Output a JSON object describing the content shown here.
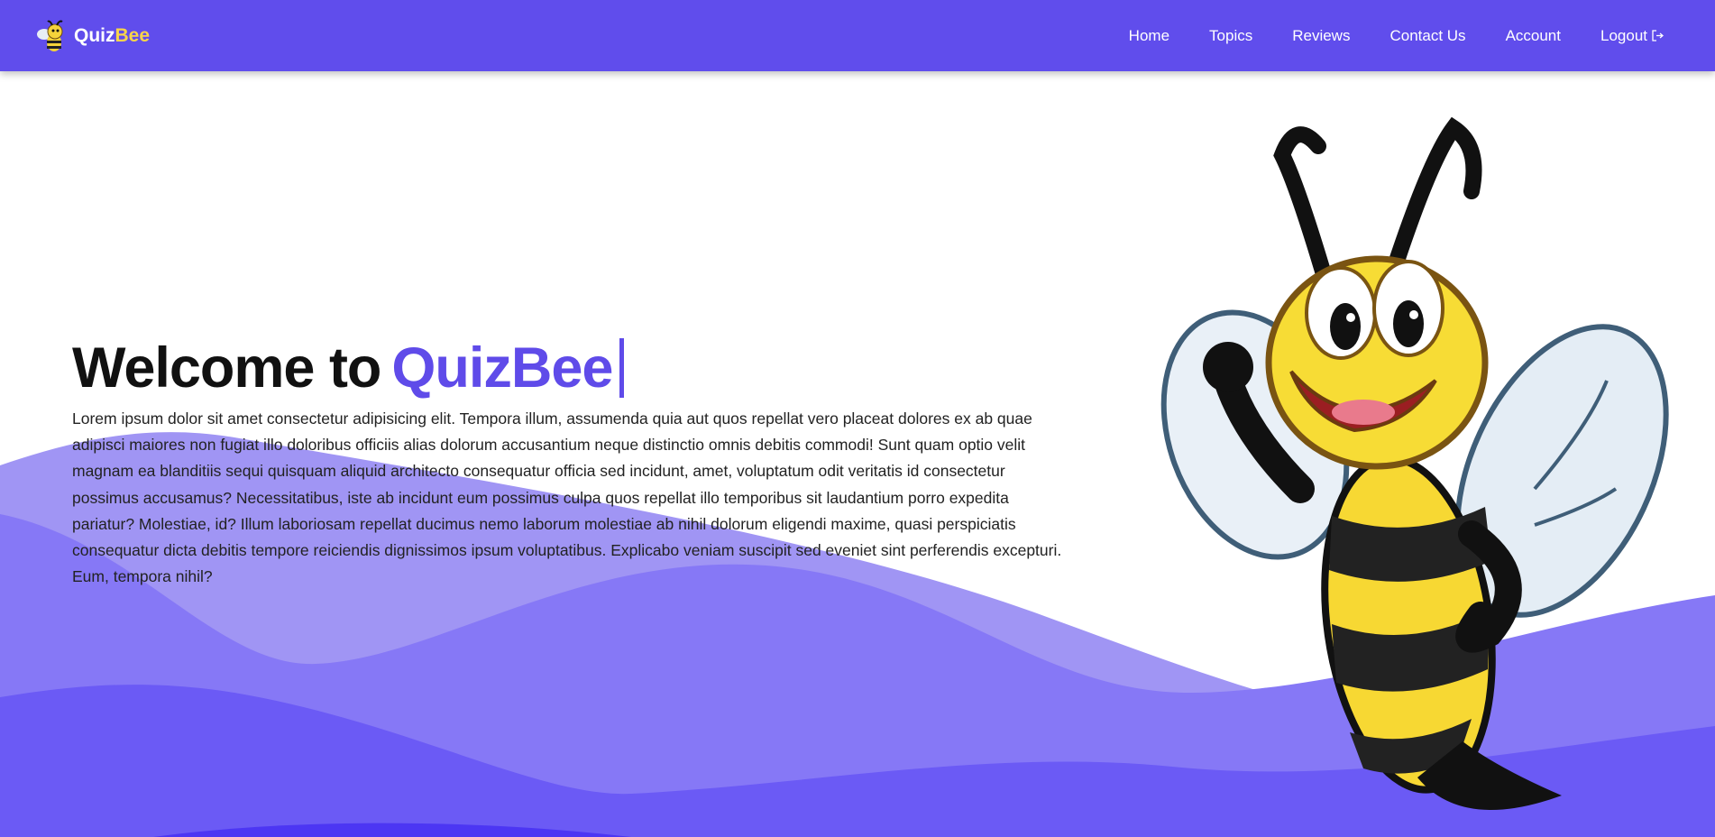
{
  "brand": {
    "part1": "Quiz",
    "part2": "Bee"
  },
  "nav": {
    "items": [
      {
        "label": "Home"
      },
      {
        "label": "Topics"
      },
      {
        "label": "Reviews"
      },
      {
        "label": "Contact Us"
      },
      {
        "label": "Account"
      },
      {
        "label": "Logout",
        "icon": "logout-icon"
      }
    ]
  },
  "hero": {
    "title_prefix": "Welcome to",
    "title_brand": "QuizBee",
    "body": "Lorem ipsum dolor sit amet consectetur adipisicing elit. Tempora illum, assumenda quia aut quos repellat vero placeat dolores ex ab quae adipisci maiores non fugiat illo doloribus officiis alias dolorum accusantium neque distinctio omnis debitis commodi! Sunt quam optio velit magnam ea blanditiis sequi quisquam aliquid architecto consequatur officia sed incidunt, amet, voluptatum odit veritatis id consectetur possimus accusamus? Necessitatibus, iste ab incidunt eum possimus culpa quos repellat illo temporibus sit laudantium porro expedita pariatur? Molestiae, id? Illum laboriosam repellat ducimus nemo laborum molestiae ab nihil dolorum eligendi maxime, quasi perspiciatis consequatur dicta debitis tempore reiciendis dignissimos ipsum voluptatibus. Explicabo veniam suscipit sed eveniet sint perferendis excepturi. Eum, tempora nihil?"
  },
  "colors": {
    "primary": "#604dec",
    "accent": "#f7d54a",
    "wave_light": "#a095f4",
    "wave_mid": "#8678f6",
    "wave_dark": "#6b5af5",
    "wave_darkest": "#4c36f3"
  }
}
